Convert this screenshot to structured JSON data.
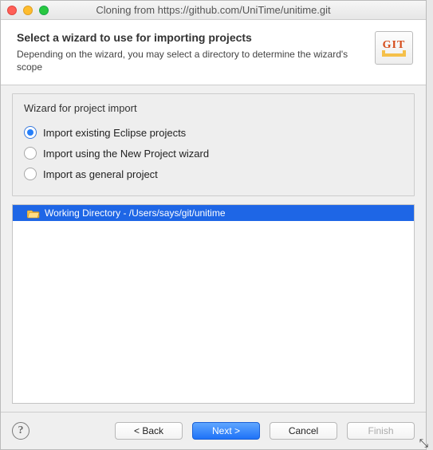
{
  "window": {
    "title": "Cloning from https://github.com/UniTime/unitime.git"
  },
  "header": {
    "heading": "Select a wizard to use for importing projects",
    "subtext": "Depending on the wizard, you may select a directory to determine the wizard's scope",
    "git_label": "GIT"
  },
  "wizard_group": {
    "title": "Wizard for project import",
    "options": [
      {
        "label": "Import existing Eclipse projects",
        "selected": true
      },
      {
        "label": "Import using the New Project wizard",
        "selected": false
      },
      {
        "label": "Import as general project",
        "selected": false
      }
    ]
  },
  "tree": {
    "rows": [
      {
        "label": "Working Directory - /Users/says/git/unitime",
        "selected": true
      }
    ]
  },
  "footer": {
    "help_glyph": "?",
    "back": "< Back",
    "next": "Next >",
    "cancel": "Cancel",
    "finish": "Finish"
  }
}
